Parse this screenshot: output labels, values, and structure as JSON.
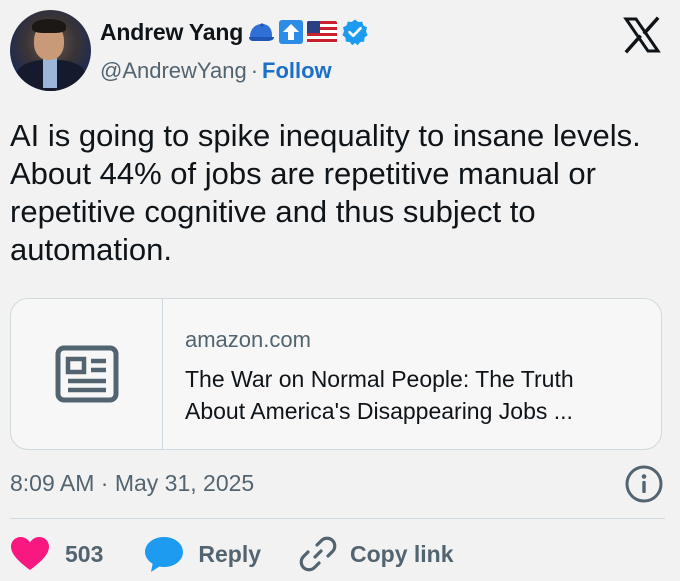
{
  "author": {
    "name": "Andrew Yang",
    "handle": "@AndrewYang",
    "separator": "·",
    "follow_label": "Follow",
    "badges": [
      "cap-emoji",
      "up-arrow-emoji",
      "us-flag-emoji",
      "verified-badge"
    ]
  },
  "tweet": {
    "text": "AI is going to spike inequality to insane levels.  About 44% of jobs are repetitive manual or repetitive cognitive and thus subject to automation."
  },
  "link_card": {
    "domain": "amazon.com",
    "title_line1": "The War on Normal People: The Truth",
    "title_line2": "About America's Disappearing Jobs ...",
    "icon": "article-icon"
  },
  "timestamp": "8:09 AM · May 31, 2025",
  "actions": {
    "like_count": "503",
    "reply_label": "Reply",
    "copy_link_label": "Copy link"
  },
  "colors": {
    "background": "#f2f2f2",
    "like": "#f91880",
    "reply": "#1d9bf0",
    "link": "#1d70c7",
    "secondary_text": "#536471"
  }
}
